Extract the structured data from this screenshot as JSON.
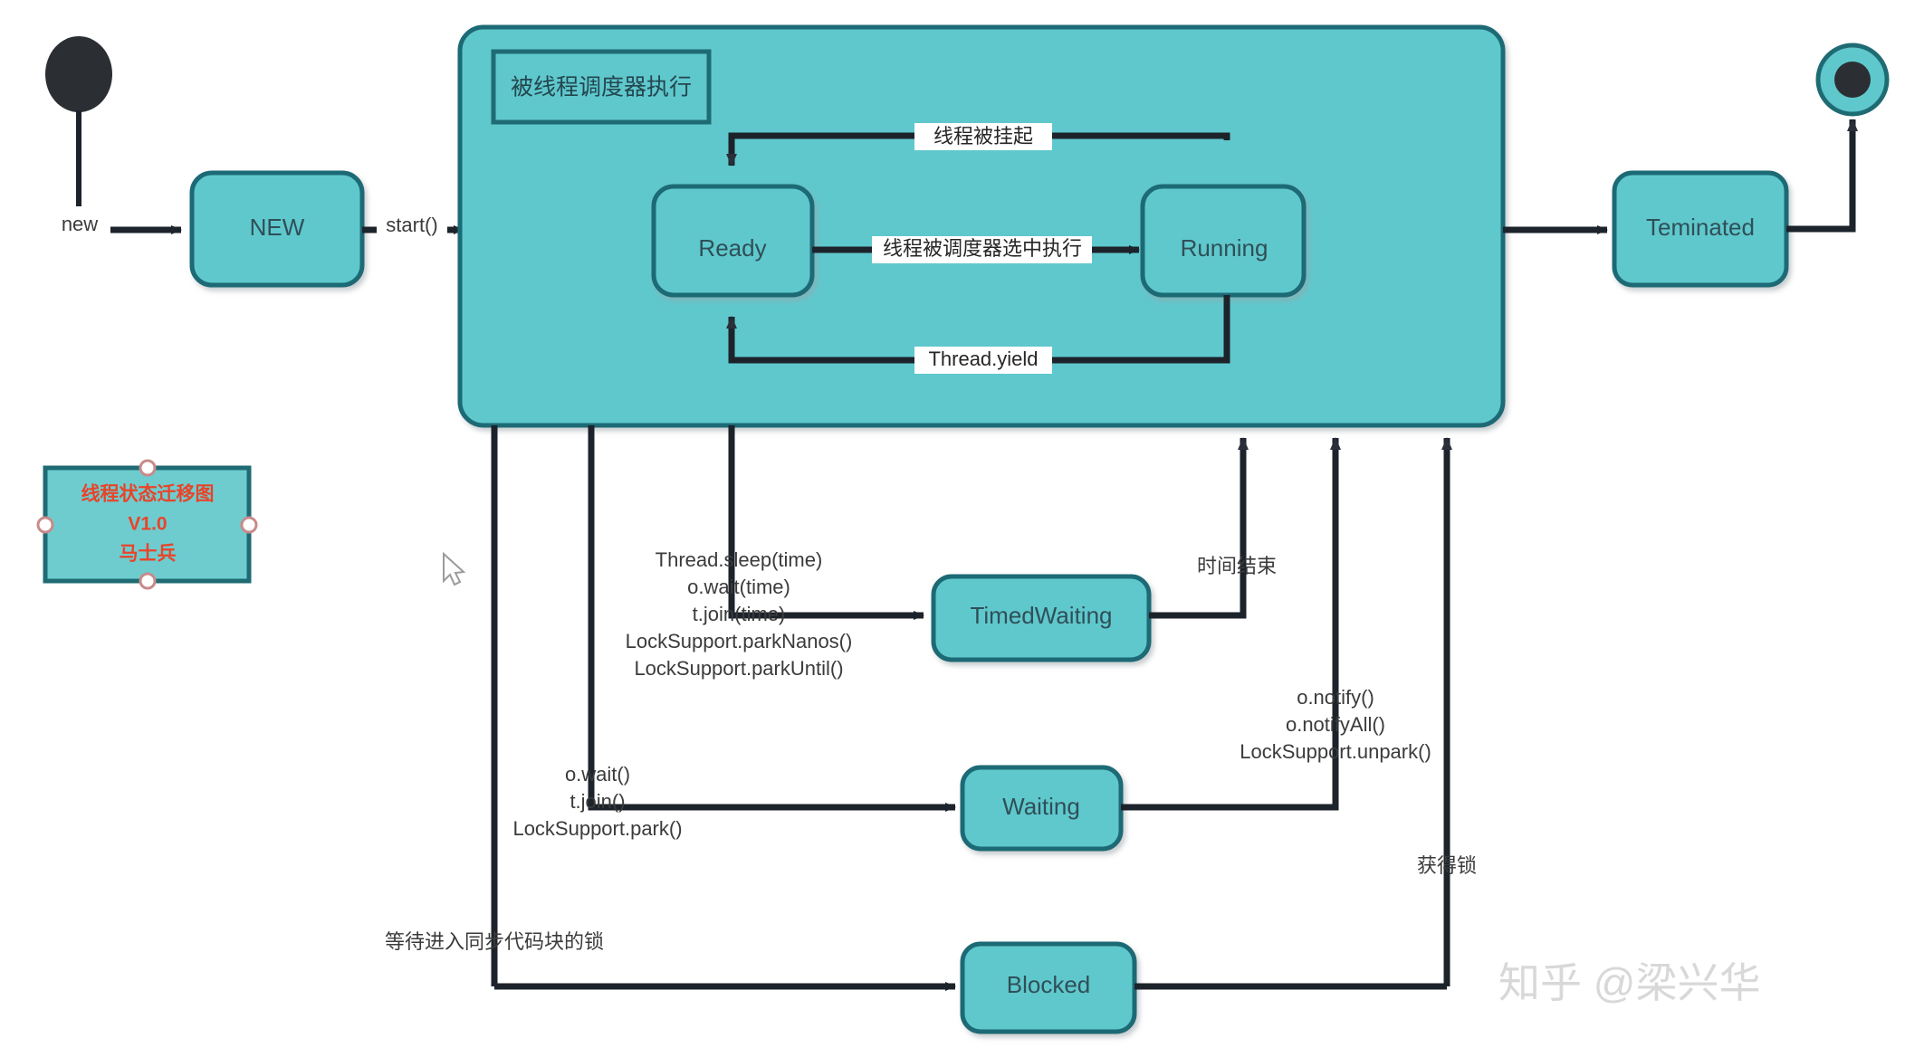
{
  "diagram": {
    "title_box": {
      "line1": "线程状态迁移图",
      "line2": "V1.0",
      "line3": "马士兵"
    },
    "watermark": "知乎 @梁兴华",
    "group_label": "被线程调度器执行",
    "states": {
      "new": "NEW",
      "ready": "Ready",
      "running": "Running",
      "terminated": "Teminated",
      "timed_waiting": "TimedWaiting",
      "waiting": "Waiting",
      "blocked": "Blocked"
    },
    "transitions": {
      "start_new": "new",
      "new_to_group": "start()",
      "suspended": "线程被挂起",
      "scheduled": "线程被调度器选中执行",
      "yield": "Thread.yield",
      "time_over": "时间结束",
      "acquire_lock": "获得锁",
      "wait_for_lock": "等待进入同步代码块的锁",
      "to_timed_waiting": [
        "Thread.sleep(time)",
        "o.wait(time)",
        "t.join(time)",
        "LockSupport.parkNanos()",
        "LockSupport.parkUntil()"
      ],
      "to_waiting": [
        "o.wait()",
        "t.join()",
        "LockSupport.park()"
      ],
      "from_waiting": [
        "o.notify()",
        "o.notifyAll()",
        "LockSupport.unpark()"
      ]
    },
    "colors": {
      "state_fill": "#5fc8cd",
      "state_stroke": "#1f6b74",
      "group_fill": "#5fc8cd",
      "group_stroke": "#1f6b74",
      "edge": "#1c232b",
      "start_node": "#2b2f33",
      "legend_text": "#e8442a",
      "watermark": "#d8d8d8",
      "background": "#ffffff"
    }
  }
}
